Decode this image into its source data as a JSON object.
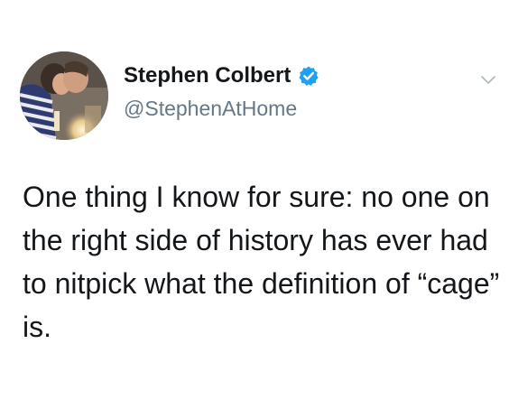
{
  "tweet": {
    "author": {
      "display_name": "Stephen Colbert",
      "handle": "@StephenAtHome",
      "verified": true,
      "avatar_icon": "profile-photo"
    },
    "text": "One thing I know for sure: no one on the right side of history has ever had to nitpick what the definition of “cage” is.",
    "menu_icon": "chevron-down-icon"
  },
  "colors": {
    "name": "#14171a",
    "handle": "#657786",
    "verified_badge": "#1da1f2",
    "chevron": "#aab8c2",
    "background": "#ffffff"
  }
}
